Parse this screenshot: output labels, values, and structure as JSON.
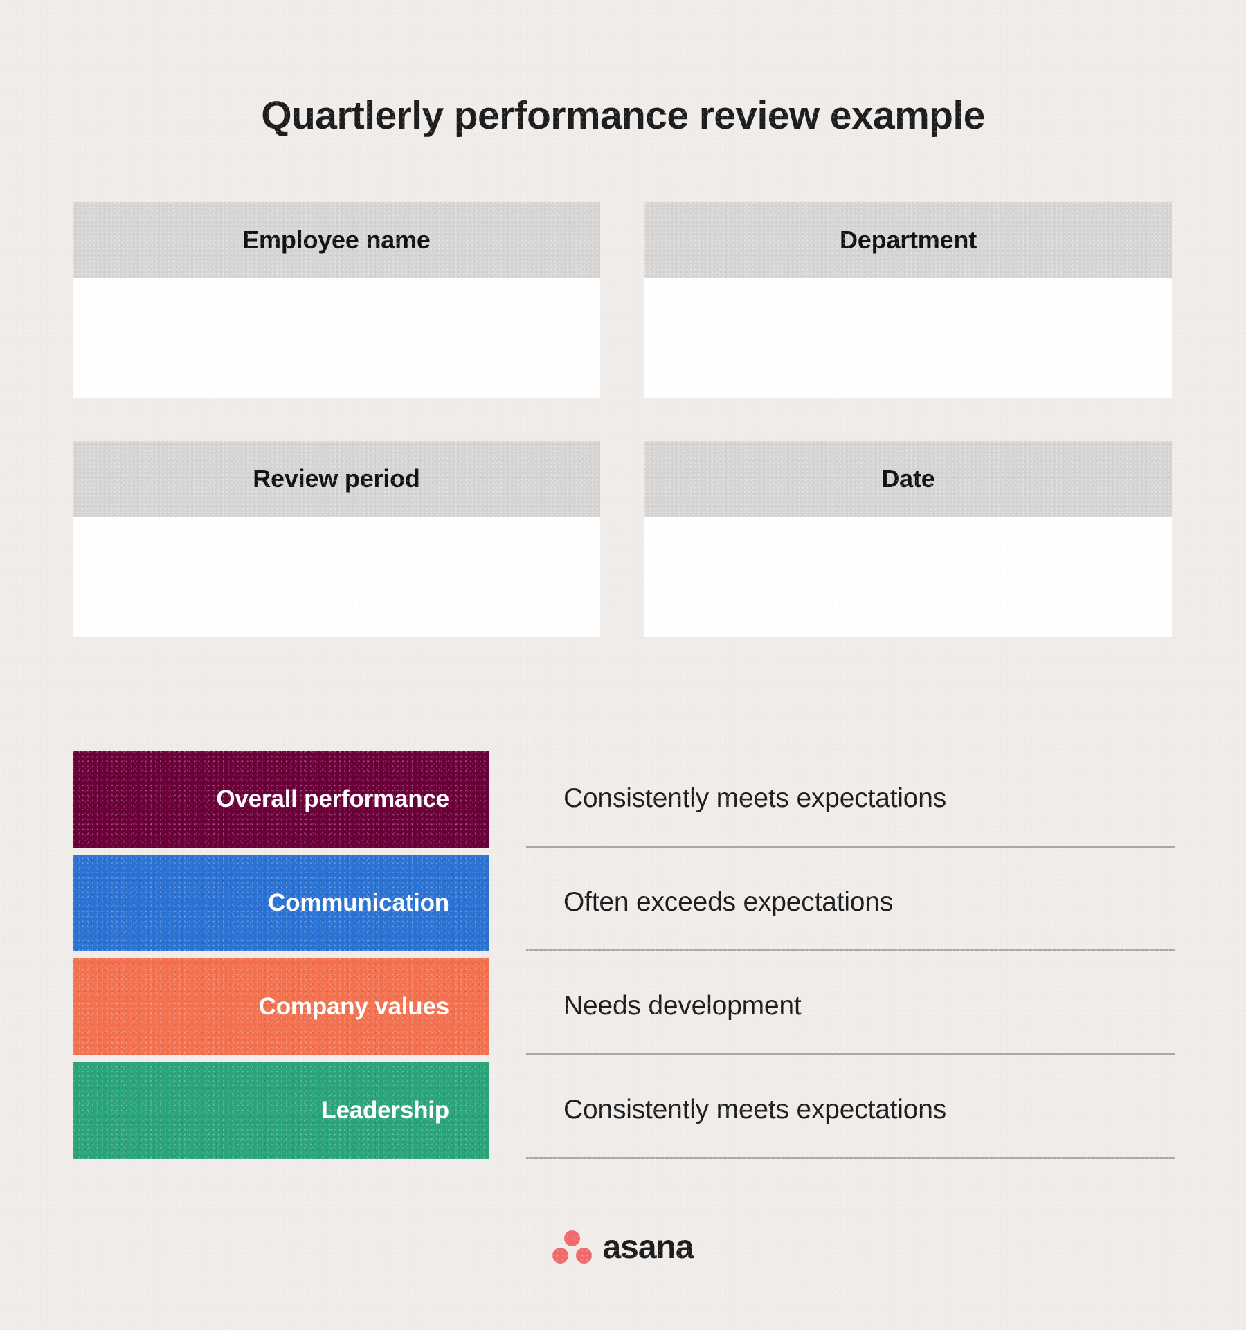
{
  "page": {
    "title": "Quartlerly performance review example",
    "background_color": "#efecea"
  },
  "form_fields": [
    {
      "label": "Employee name",
      "value": ""
    },
    {
      "label": "Department",
      "value": ""
    },
    {
      "label": "Review period",
      "value": ""
    },
    {
      "label": "Date",
      "value": ""
    }
  ],
  "ratings": [
    {
      "category": "Overall performance",
      "rating": "Consistently meets expectations",
      "color": "#6b0038"
    },
    {
      "category": "Communication",
      "rating": "Often exceeds expectations",
      "color": "#2a72d4"
    },
    {
      "category": "Company values",
      "rating": "Needs development",
      "color": "#f4714f"
    },
    {
      "category": "Leadership",
      "rating": "Consistently meets expectations",
      "color": "#2aa47a"
    }
  ],
  "footer": {
    "brand_name": "asana",
    "logo_icon": "asana-three-dots-icon",
    "logo_color": "#f06a6a"
  },
  "style": {
    "header_band_color": "#d6d4d3",
    "field_body_color": "#ffffff",
    "divider_color": "#a9a6a3",
    "text_color": "#1d1d1d"
  }
}
